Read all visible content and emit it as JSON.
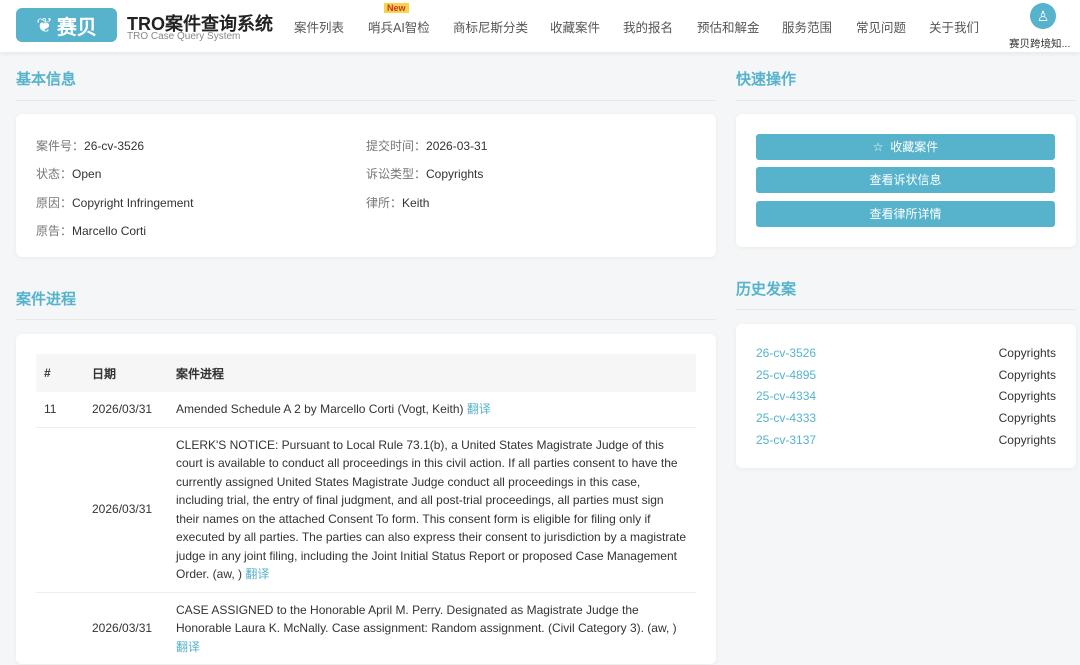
{
  "header": {
    "logo": "赛贝",
    "title": "TRO案件查询系统",
    "subtitle": "TRO Case Query System",
    "new_badge": "New",
    "nav": [
      "案件列表",
      "哨兵AI智检",
      "商标尼斯分类",
      "收藏案件",
      "我的报名",
      "预估和解金",
      "服务范围",
      "常见问题",
      "关于我们"
    ],
    "user": "赛贝跨境知..."
  },
  "basic": {
    "title": "基本信息",
    "case_no_label": "案件号：",
    "case_no": "26-cv-3526",
    "submit_label": "提交时间：",
    "submit": "2026-03-31",
    "status_label": "状态：",
    "status": "Open",
    "type_label": "诉讼类型：",
    "type": "Copyrights",
    "cause_label": "原因：",
    "cause": "Copyright Infringement",
    "firm_label": "律所：",
    "firm": "Keith",
    "plaintiff_label": "原告：",
    "plaintiff": "Marcello Corti"
  },
  "progress": {
    "title": "案件进程",
    "headers": [
      "#",
      "日期",
      "案件进程"
    ],
    "translate": "翻译",
    "rows": [
      {
        "num": "11",
        "date": "2026/03/31",
        "text": "Amended Schedule A 2 by Marcello Corti (Vogt, Keith)"
      },
      {
        "num": "",
        "date": "2026/03/31",
        "text": "CLERK'S NOTICE: Pursuant to Local Rule 73.1(b), a United States Magistrate Judge of this court is available to conduct all proceedings in this civil action. If all parties consent to have the currently assigned United States Magistrate Judge conduct all proceedings in this case, including trial, the entry of final judgment, and all post-trial proceedings, all parties must sign their names on the attached Consent To form. This consent form is eligible for filing only if executed by all parties. The parties can also express their consent to jurisdiction by a magistrate judge in any joint filing, including the Joint Initial Status Report or proposed Case Management Order. (aw, )"
      },
      {
        "num": "",
        "date": "2026/03/31",
        "text": "CASE ASSIGNED to the Honorable April M. Perry. Designated as Magistrate Judge the Honorable Laura K. McNally. Case assignment: Random assignment. (Civil Category 3). (aw, )"
      }
    ]
  },
  "quick": {
    "title": "快速操作",
    "favorite": "收藏案件",
    "complaint": "查看诉状信息",
    "firm": "查看律所详情"
  },
  "history": {
    "title": "历史发案",
    "items": [
      {
        "case": "26-cv-3526",
        "type": "Copyrights"
      },
      {
        "case": "25-cv-4895",
        "type": "Copyrights"
      },
      {
        "case": "25-cv-4334",
        "type": "Copyrights"
      },
      {
        "case": "25-cv-4333",
        "type": "Copyrights"
      },
      {
        "case": "25-cv-3137",
        "type": "Copyrights"
      }
    ]
  }
}
